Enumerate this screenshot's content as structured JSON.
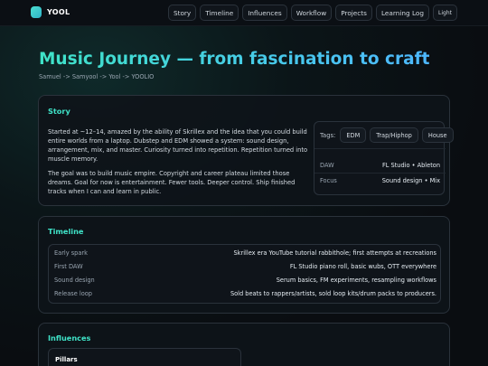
{
  "brand": {
    "name": "YOOL"
  },
  "nav": {
    "items": [
      "Story",
      "Timeline",
      "Influences",
      "Workflow",
      "Projects",
      "Learning Log"
    ],
    "theme_toggle": "Light"
  },
  "hero": {
    "title": "Music Journey — from fascination to craft",
    "breadcrumb": "Samuel -> Samyool -> Yool -> YOOLIO"
  },
  "story": {
    "title": "Story",
    "paragraphs": [
      "Started at ~12–14, amazed by the ability of Skrillex and the idea that you could build entire worlds from a laptop. Dubstep and EDM showed a system: sound design, arrangement, mix, and master. Curiosity turned into repetition. Repetition turned into muscle memory.",
      "The goal was to build music empire. Copyright and career plateau limited those dreams. Goal for now is entertainment. Fewer tools. Deeper control. Ship finished tracks when I can and learn in public."
    ],
    "tags_label": "Tags:",
    "tags": [
      "EDM",
      "Trap/Hiphop",
      "House"
    ],
    "details": [
      {
        "key": "DAW",
        "value": "FL Studio • Ableton"
      },
      {
        "key": "Focus",
        "value": "Sound design • Mix"
      }
    ]
  },
  "timeline": {
    "title": "Timeline",
    "rows": [
      {
        "key": "Early spark",
        "value": "Skrillex era YouTube tutorial rabbithole; first attempts at recreations"
      },
      {
        "key": "First DAW",
        "value": "FL Studio piano roll, basic wubs, OTT everywhere"
      },
      {
        "key": "Sound design",
        "value": "Serum basics, FM experiments, resampling workflows"
      },
      {
        "key": "Release loop",
        "value": "Sold beats to rappers/artists, sold loop kits/drum packs to producers."
      }
    ]
  },
  "influences": {
    "title": "Influences",
    "pillars_title": "Pillars"
  }
}
